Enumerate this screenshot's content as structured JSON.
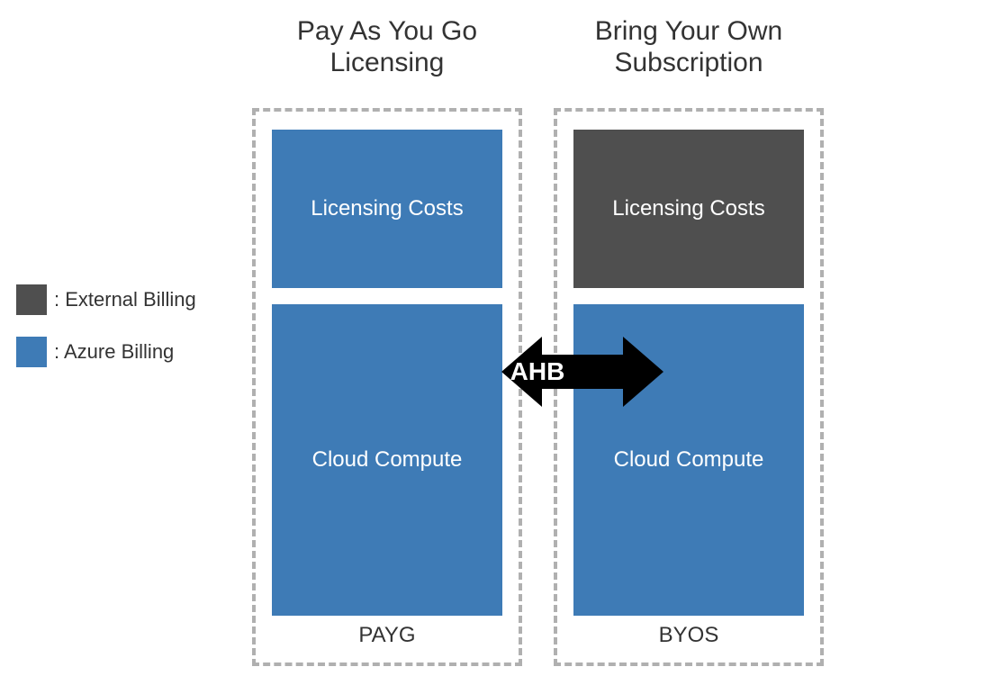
{
  "colors": {
    "azure": "#3e7bb6",
    "external": "#4f4f4f",
    "dashed": "#b0b0b0",
    "arrow": "#000000"
  },
  "legend": {
    "external_label": ": External Billing",
    "azure_label": ": Azure Billing"
  },
  "left": {
    "title_line1": "Pay As You Go",
    "title_line2": "Licensing",
    "licensing_label": "Licensing Costs",
    "compute_label": "Cloud Compute",
    "footer": "PAYG"
  },
  "right": {
    "title_line1": "Bring Your Own",
    "title_line2": "Subscription",
    "licensing_label": "Licensing Costs",
    "compute_label": "Cloud Compute",
    "footer": "BYOS"
  },
  "arrow": {
    "label": "AHB"
  }
}
